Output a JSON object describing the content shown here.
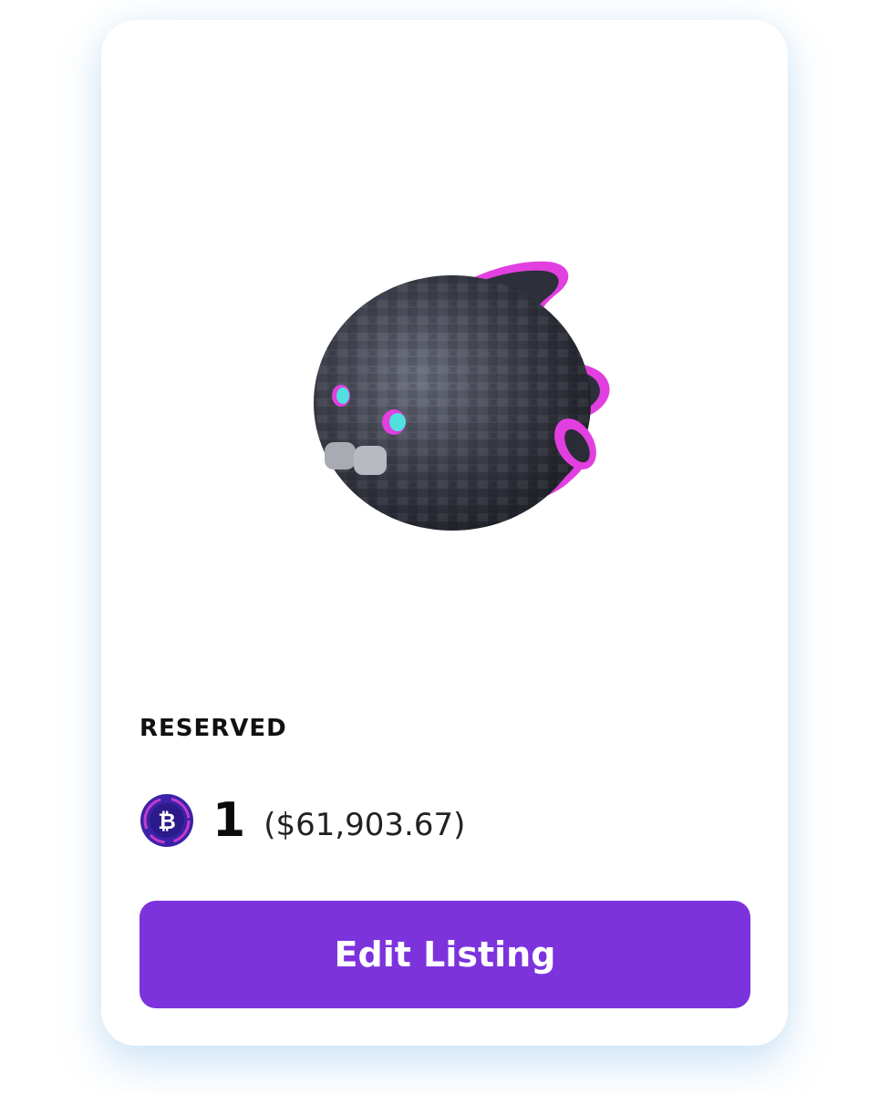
{
  "listing": {
    "status": "RESERVED",
    "price_amount": "1",
    "price_fiat": "($61,903.67)",
    "currency_icon": "bitcoin-icon",
    "artwork_icon": "creature-artwork"
  },
  "actions": {
    "edit_label": "Edit Listing"
  },
  "colors": {
    "button": "#7c33dc",
    "coin_ring": "#3b22a8",
    "accent_pink": "#e23fe0",
    "accent_cyan": "#4fe0e0"
  }
}
